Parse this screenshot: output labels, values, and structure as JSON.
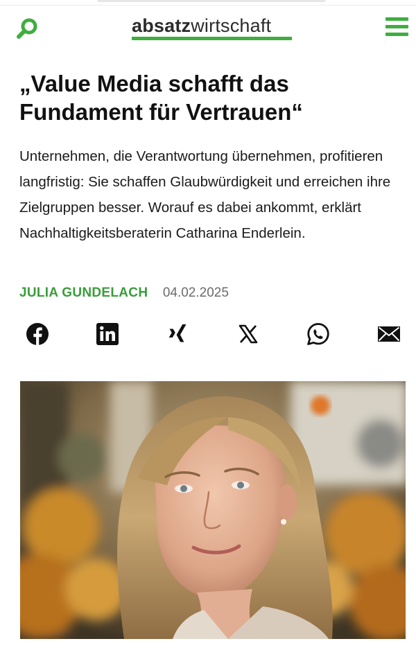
{
  "header": {
    "logo_bold": "absatz",
    "logo_light": "wirtschaft",
    "search_icon": "search-icon",
    "menu_icon": "hamburger-menu-icon",
    "brand_color": "#3fae3f"
  },
  "article": {
    "headline": "„Value Media schafft das Fundament für Vertrauen“",
    "lead": "Unternehmen, die Verantwortung übernehmen, profitieren langfristig: Sie schaffen Glaubwürdigkeit und erreichen ihre Zielgruppen besser. Worauf es dabei ankommt, erklärt Nachhaltigkeitsberaterin Catharina Enderlein.",
    "author": "JULIA GUNDELACH",
    "date": "04.02.2025"
  },
  "share": {
    "icons": [
      "facebook-icon",
      "linkedin-icon",
      "xing-icon",
      "x-icon",
      "whatsapp-icon",
      "mail-icon"
    ]
  },
  "colors": {
    "text": "#111111",
    "meta_gray": "#6b6b6b",
    "author_green": "#3a9d3a"
  }
}
